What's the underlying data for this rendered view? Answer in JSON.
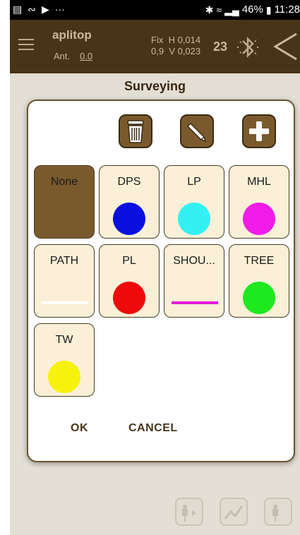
{
  "status_bar": {
    "left_icons": [
      "gallery-icon",
      "cast-icon",
      "play-store-icon",
      "more-icon"
    ],
    "battery": "46%",
    "time": "11:28"
  },
  "app_bar": {
    "title": "aplitop",
    "ant_label": "Ant.",
    "ant_value": "0.0",
    "fix_label": "Fix",
    "h_value": "H 0,014",
    "pdop": "0,9",
    "v_value": "V 0,023",
    "satellites": "23"
  },
  "page": {
    "title": "Surveying"
  },
  "dialog": {
    "tools": [
      {
        "name": "delete",
        "icon": "trash-icon"
      },
      {
        "name": "edit",
        "icon": "pencil-icon"
      },
      {
        "name": "add",
        "icon": "plus-icon"
      }
    ],
    "codes": [
      {
        "label": "None",
        "style": "none",
        "color": "",
        "selected": true
      },
      {
        "label": "DPS",
        "style": "point",
        "color": "#0a0fe0",
        "selected": false
      },
      {
        "label": "LP",
        "style": "point",
        "color": "#33f0f4",
        "selected": false
      },
      {
        "label": "MHL",
        "style": "point",
        "color": "#f11ce8",
        "selected": false
      },
      {
        "label": "PATH",
        "style": "line",
        "color": "#ffffff",
        "selected": false
      },
      {
        "label": "PL",
        "style": "point",
        "color": "#ee0a0a",
        "selected": false
      },
      {
        "label": "SHOU...",
        "style": "line",
        "color": "#e21ad8",
        "selected": false
      },
      {
        "label": "TREE",
        "style": "point",
        "color": "#1ee81e",
        "selected": false
      },
      {
        "label": "TW",
        "style": "point",
        "color": "#f7f20c",
        "selected": false
      }
    ],
    "ok_label": "OK",
    "cancel_label": "CANCEL"
  }
}
